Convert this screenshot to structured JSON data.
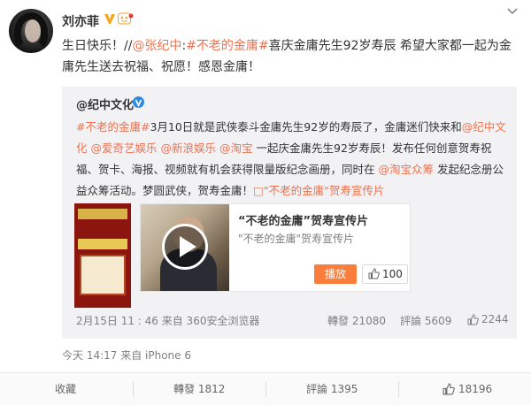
{
  "post": {
    "username": "刘亦菲",
    "text_intro": "生日快乐！//",
    "mention_1": "@张纪中",
    "colon": ":",
    "hashtag_1": "#不老的金庸#",
    "text_mid": "喜庆金庸先生92岁寿辰 希望大家都一起为金庸先生送去祝福、祝愿！感恩金庸！",
    "time": "今天 14:17 来自 iPhone 6"
  },
  "repost": {
    "author": "@纪中文化",
    "hashtag": "#不老的金庸#",
    "t1": "3月10日就是武侠泰斗金庸先生92岁的寿辰了，金庸迷们快来和",
    "m1": "@纪中文化",
    "m2": "@爱奇艺娱乐",
    "m3": "@新浪娱乐",
    "m4": "@淘宝",
    "t2": "一起庆金庸先生92岁寿辰！发布任何创意贺寿祝福、贺卡、海报、视频就有机会获得限量版纪念画册，同时在",
    "m5": "@淘宝众筹",
    "t3": "发起纪念册公益众筹活动。梦圆武侠，贺寿金庸！",
    "link": "□\"不老的金庸\"贺寿宣传片",
    "video": {
      "title": "“不老的金庸”贺寿宣传片",
      "desc": "\"不老的金庸\"贺寿宣传片",
      "play_label": "播放",
      "like_count": "100"
    },
    "time": "2月15日 11 : 46 来自 360安全浏览器",
    "reposts": "轉發 21080",
    "comments": "評論 5609",
    "likes": "2244"
  },
  "actions": {
    "favorite": "收藏",
    "repost": "轉發 1812",
    "comment": "評論 1395",
    "like": "18196"
  },
  "colors": {
    "link": "#eb7350",
    "verified": "#f5a623",
    "play_button": "#fa7d3c"
  }
}
